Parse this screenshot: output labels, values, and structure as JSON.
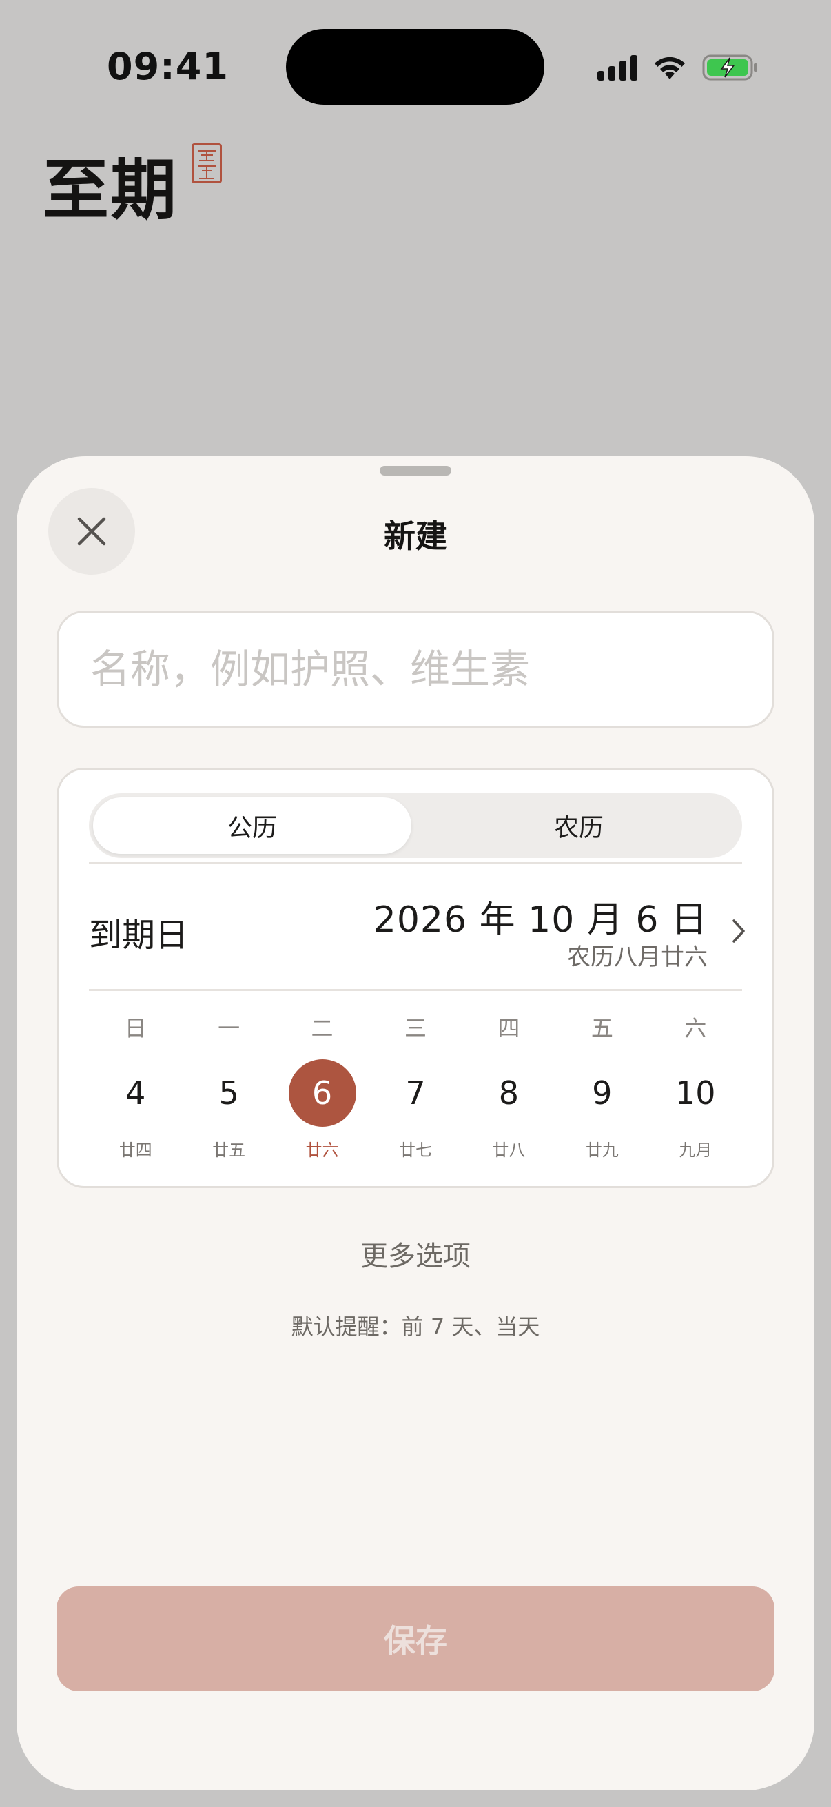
{
  "status_bar": {
    "time": "09:41",
    "icons": [
      "cellular-signal-icon",
      "wifi-icon",
      "battery-charging-icon"
    ]
  },
  "app": {
    "title": "至期",
    "seal_text": "至期"
  },
  "sheet": {
    "title": "新建",
    "close_icon": "close-icon",
    "name_input": {
      "value": "",
      "placeholder": "名称，例如护照、维生素"
    },
    "calendar_mode": {
      "options": [
        "公历",
        "农历"
      ],
      "selected": "公历"
    },
    "due": {
      "label": "到期日",
      "date": "2026 年 10 月 6 日",
      "lunar": "农历八月廿六"
    },
    "week": {
      "weekdays": [
        "日",
        "一",
        "二",
        "三",
        "四",
        "五",
        "六"
      ],
      "days": [
        {
          "day": "4",
          "lunar": "廿四"
        },
        {
          "day": "5",
          "lunar": "廿五"
        },
        {
          "day": "6",
          "lunar": "廿六",
          "selected": true
        },
        {
          "day": "7",
          "lunar": "廿七"
        },
        {
          "day": "8",
          "lunar": "廿八"
        },
        {
          "day": "9",
          "lunar": "廿九"
        },
        {
          "day": "10",
          "lunar": "九月"
        }
      ]
    },
    "more_options": "更多选项",
    "reminder_text": "默认提醒：前 7 天、当天",
    "save_label": "保存"
  },
  "colors": {
    "accent": "#ad5540",
    "save_disabled": "#d7afa5",
    "sheet_bg": "#f8f5f2",
    "backdrop": "#c6c5c4"
  }
}
